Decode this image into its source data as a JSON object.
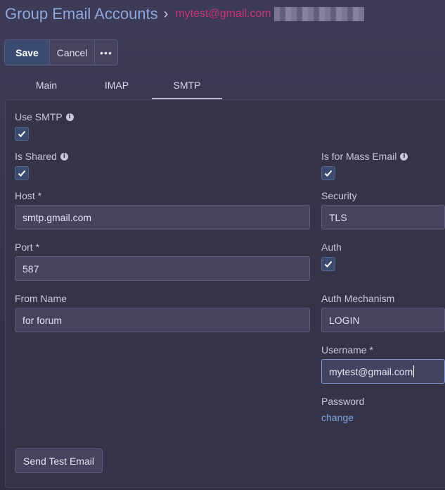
{
  "header": {
    "title": "Group Email Accounts",
    "separator": "›",
    "record_name": "mytest@gmail.com"
  },
  "toolbar": {
    "save_label": "Save",
    "cancel_label": "Cancel",
    "more_label": "•••"
  },
  "tabs": [
    {
      "label": "Main",
      "active": false
    },
    {
      "label": "IMAP",
      "active": false
    },
    {
      "label": "SMTP",
      "active": true
    }
  ],
  "form": {
    "use_smtp": {
      "label": "Use SMTP",
      "checked": true
    },
    "is_shared": {
      "label": "Is Shared",
      "checked": true
    },
    "is_for_mass_email": {
      "label": "Is for Mass Email",
      "checked": true
    },
    "host": {
      "label": "Host *",
      "value": "smtp.gmail.com"
    },
    "security": {
      "label": "Security",
      "value": "TLS"
    },
    "port": {
      "label": "Port *",
      "value": "587"
    },
    "auth": {
      "label": "Auth",
      "checked": true
    },
    "from_name": {
      "label": "From Name",
      "value": "for forum"
    },
    "auth_mechanism": {
      "label": "Auth Mechanism",
      "value": "LOGIN"
    },
    "username": {
      "label": "Username *",
      "value": "mytest@gmail.com"
    },
    "password": {
      "label": "Password",
      "link": "change"
    },
    "send_test_label": "Send Test Email"
  },
  "icons": {
    "info": "info-icon",
    "check": "checkmark-icon",
    "more": "ellipsis-icon"
  },
  "colors": {
    "title": "#8ea7dd",
    "record": "#c9357a",
    "link": "#7fa2dc",
    "background": "#3d3b57"
  }
}
